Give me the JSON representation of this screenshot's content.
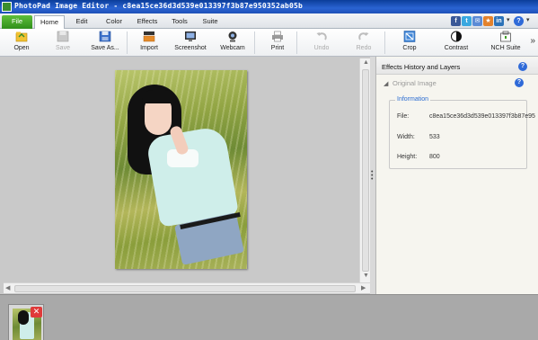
{
  "window": {
    "title": "PhotoPad Image Editor - c8ea15ce36d3d539e013397f3b87e950352ab05b"
  },
  "tabs": [
    {
      "label": "File"
    },
    {
      "label": "Home"
    },
    {
      "label": "Edit"
    },
    {
      "label": "Color"
    },
    {
      "label": "Effects"
    },
    {
      "label": "Tools"
    },
    {
      "label": "Suite"
    }
  ],
  "social": [
    {
      "icon": "facebook-icon",
      "glyph": "f",
      "color": "#3b5998"
    },
    {
      "icon": "twitter-icon",
      "glyph": "t",
      "color": "#3aa8e0"
    },
    {
      "icon": "feedback-icon",
      "glyph": "✉",
      "color": "#5b8bd6"
    },
    {
      "icon": "stumble-icon",
      "glyph": "★",
      "color": "#e3822d"
    },
    {
      "icon": "linkedin-icon",
      "glyph": "in",
      "color": "#2c72b8"
    }
  ],
  "toolbar": {
    "open": "Open",
    "save": "Save",
    "save_as": "Save As...",
    "import": "Import",
    "screenshot": "Screenshot",
    "webcam": "Webcam",
    "print": "Print",
    "undo": "Undo",
    "redo": "Redo",
    "crop": "Crop",
    "contrast": "Contrast",
    "nch_suite": "NCH Suite",
    "more": "»"
  },
  "panel": {
    "title": "Effects History and Layers",
    "layer_title": "Original Image",
    "info_legend": "Information",
    "file_label": "File:",
    "file_value": "c8ea15ce36d3d539e013397f3b87e95",
    "width_label": "Width:",
    "width_value": "533",
    "height_label": "Height:",
    "height_value": "800"
  },
  "tray": {
    "close_glyph": "✕"
  },
  "colors": {
    "accent": "#2f6ad8",
    "file_tab": "#3f9f26",
    "titlebar": "#1f50b8"
  }
}
